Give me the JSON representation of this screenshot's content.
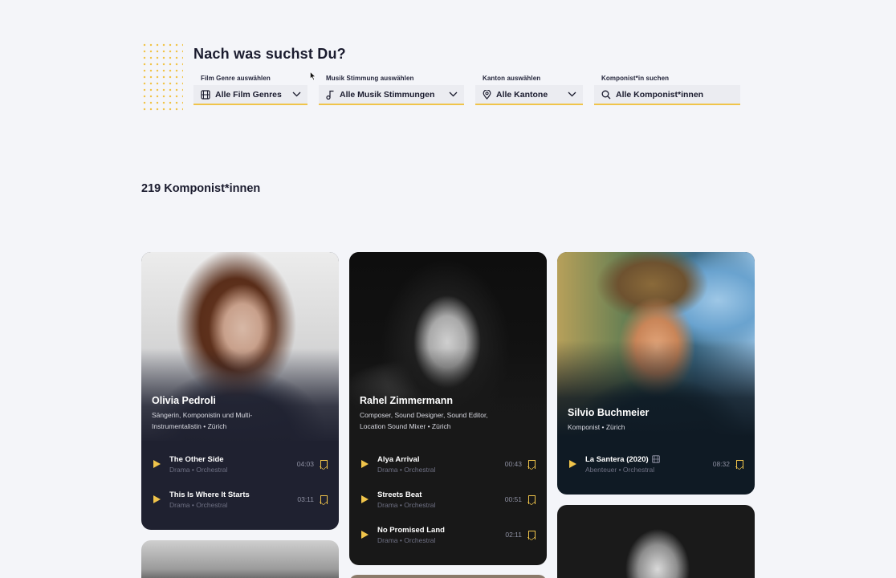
{
  "search": {
    "title": "Nach was suchst Du?",
    "filters": [
      {
        "label": "Film Genre auswählen",
        "value": "Alle Film Genres",
        "icon": "film-icon"
      },
      {
        "label": "Musik Stimmung auswählen",
        "value": "Alle Musik Stimmungen",
        "icon": "music-note-icon"
      },
      {
        "label": "Kanton auswählen",
        "value": "Alle Kantone",
        "icon": "location-pin-icon"
      },
      {
        "label": "Komponist*in suchen",
        "value": "Alle Komponist*innen",
        "icon": "search-icon"
      }
    ]
  },
  "results": {
    "count_label": "219 Komponist*innen"
  },
  "composers": [
    {
      "name": "Olivia Pedroli",
      "role": "Sängerin, Komponistin und Multi-Instrumentalistin • Zürich",
      "tracks": [
        {
          "title": "The Other Side",
          "tags": "Drama • Orchestral",
          "duration": "04:03"
        },
        {
          "title": "This Is Where It Starts",
          "tags": "Drama • Orchestral",
          "duration": "03:11"
        }
      ]
    },
    {
      "name": "Rahel Zimmermann",
      "role": "Composer, Sound Designer, Sound Editor, Location Sound Mixer • Zürich",
      "tracks": [
        {
          "title": "Alya Arrival",
          "tags": "Drama • Orchestral",
          "duration": "00:43"
        },
        {
          "title": "Streets Beat",
          "tags": "Drama • Orchestral",
          "duration": "00:51"
        },
        {
          "title": "No Promised Land",
          "tags": "Drama • Orchestral",
          "duration": "02:11"
        }
      ]
    },
    {
      "name": "Silvio Buchmeier",
      "role": "Komponist • Zürich",
      "tracks": [
        {
          "title": "La Santera (2020)",
          "tags": "Abenteuer • Orchestral",
          "duration": "08:32"
        }
      ]
    }
  ],
  "colors": {
    "accent": "#f0c44a",
    "card_dark": "#1f2130",
    "card_black": "#181818",
    "card_navy": "#0f1a24"
  }
}
